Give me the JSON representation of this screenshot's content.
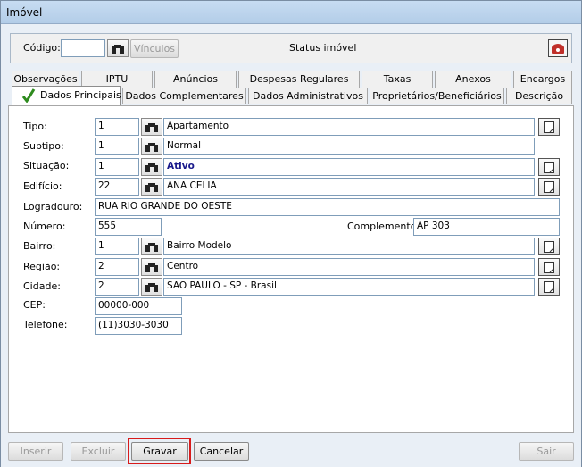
{
  "window": {
    "title": "Imóvel"
  },
  "header": {
    "codigo_label": "Código:",
    "codigo_value": "",
    "vinculos_label": "Vínculos",
    "status_label": "Status imóvel"
  },
  "tabs_top": [
    "Observações",
    "IPTU",
    "Anúncios",
    "Despesas Regulares",
    "Taxas",
    "Anexos",
    "Encargos"
  ],
  "tabs_bottom": [
    "Dados Principais",
    "Dados Complementares",
    "Dados Administrativos",
    "Proprietários/Beneficiários",
    "Descrição"
  ],
  "fields": {
    "tipo": {
      "label": "Tipo:",
      "code": "1",
      "value": "Apartamento"
    },
    "subtipo": {
      "label": "Subtipo:",
      "code": "1",
      "value": "Normal"
    },
    "situacao": {
      "label": "Situação:",
      "code": "1",
      "value": "Ativo"
    },
    "edificio": {
      "label": "Edifício:",
      "code": "22",
      "value": "ANA CELIA"
    },
    "logradouro": {
      "label": "Logradouro:",
      "value": "RUA RIO GRANDE DO OESTE"
    },
    "numero": {
      "label": "Número:",
      "value": "555"
    },
    "complemento": {
      "label": "Complemento:",
      "value": "AP 303"
    },
    "bairro": {
      "label": "Bairro:",
      "code": "1",
      "value": "Bairro Modelo"
    },
    "regiao": {
      "label": "Região:",
      "code": "2",
      "value": "Centro"
    },
    "cidade": {
      "label": "Cidade:",
      "code": "2",
      "value": "SAO PAULO - SP - Brasil"
    },
    "cep": {
      "label": "CEP:",
      "value": "00000-000"
    },
    "telefone": {
      "label": "Telefone:",
      "value": "(11)3030-3030"
    }
  },
  "actions": {
    "inserir": "Inserir",
    "excluir": "Excluir",
    "gravar": "Gravar",
    "cancelar": "Cancelar",
    "sair": "Sair"
  },
  "colors": {
    "highlight": "#d81b1b",
    "active_status": "#1a1a8c",
    "check": "#2e8b1e"
  },
  "icons": {
    "lookup": "binoculars-icon",
    "detail": "document-icon",
    "phone": "telephone-icon",
    "check": "checkmark-icon"
  }
}
